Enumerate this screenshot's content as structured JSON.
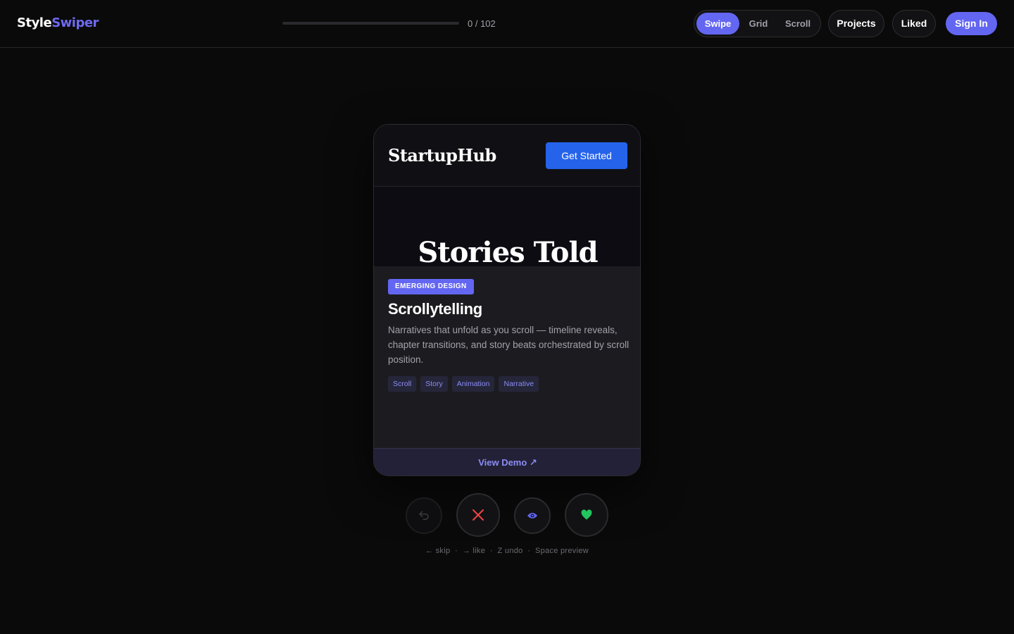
{
  "app": {
    "logo_part1": "Style",
    "logo_part2": "Swiper"
  },
  "progress": {
    "current": 0,
    "total": 102,
    "text": "0 / 102"
  },
  "modes": [
    {
      "label": "Swipe",
      "active": true
    },
    {
      "label": "Grid",
      "active": false
    },
    {
      "label": "Scroll",
      "active": false
    }
  ],
  "nav": {
    "projects": "Projects",
    "liked": "Liked",
    "sign_in": "Sign In"
  },
  "card": {
    "preview": {
      "brand": "StartupHub",
      "cta": "Get Started",
      "hero": "Stories Told"
    },
    "badge": "EMERGING DESIGN",
    "title": "Scrollytelling",
    "description": "Narratives that unfold as you scroll — timeline reveals, chapter transitions, and story beats orchestrated by scroll position.",
    "tags": [
      "Scroll",
      "Story",
      "Animation",
      "Narrative"
    ],
    "demo_link": "View Demo ↗"
  },
  "actions": [
    {
      "name": "undo-icon"
    },
    {
      "name": "close-icon",
      "color": "#ef4444"
    },
    {
      "name": "eye-icon",
      "color": "#6366f1"
    },
    {
      "name": "heart-icon",
      "color": "#22c55e"
    }
  ],
  "hints": "← skip  ·  → like  ·  Z undo  ·  Space preview",
  "colors": {
    "accent": "#6366f1",
    "background": "#0a0a0a",
    "cta_blue": "#2563eb"
  }
}
